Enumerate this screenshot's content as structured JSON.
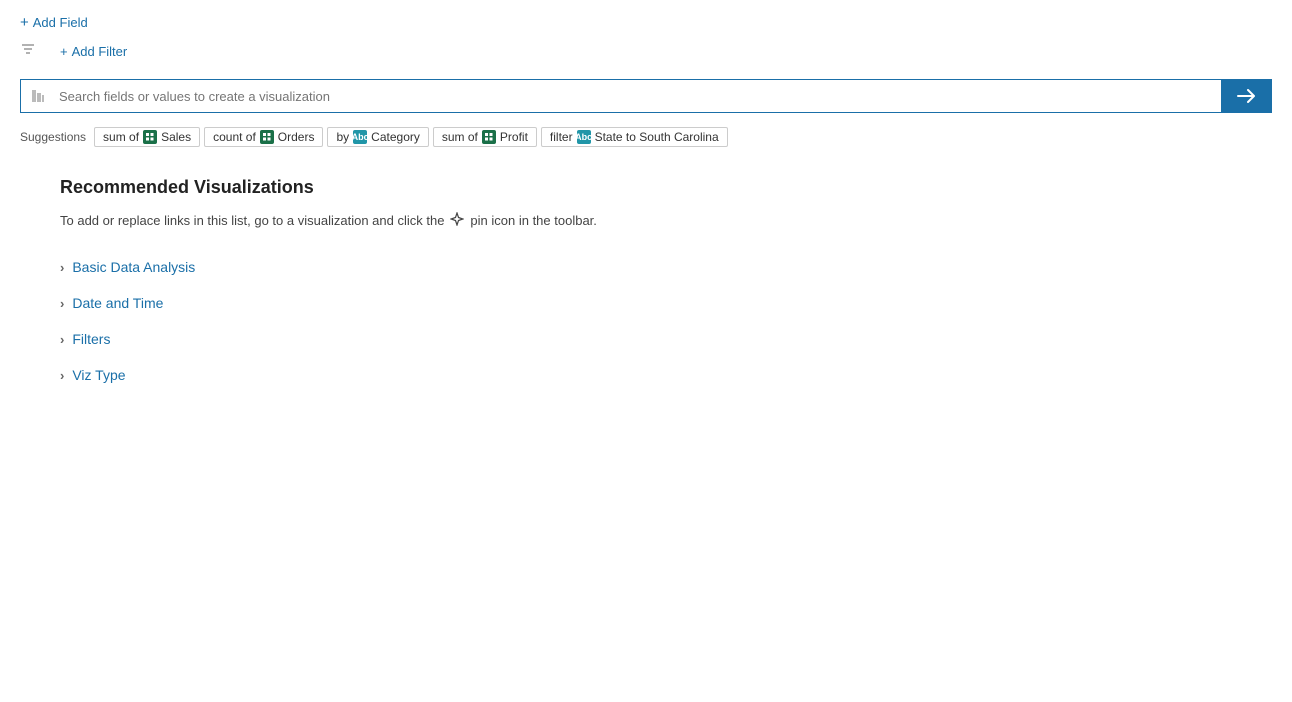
{
  "toolbar": {
    "add_field_label": "Add Field",
    "add_filter_label": "Add Filter"
  },
  "search": {
    "placeholder": "Search fields or values to create a visualization",
    "submit_arrow": "→"
  },
  "suggestions": {
    "label": "Suggestions",
    "chips": [
      {
        "id": "sum-sales",
        "prefix": "sum of",
        "icon_type": "measure",
        "label": "Sales"
      },
      {
        "id": "count-orders",
        "prefix": "count of",
        "icon_type": "measure",
        "label": "Orders"
      },
      {
        "id": "by-category",
        "prefix": "by",
        "icon_type": "dimension",
        "label": "Category"
      },
      {
        "id": "sum-profit",
        "prefix": "sum of",
        "icon_type": "measure",
        "label": "Profit"
      },
      {
        "id": "filter-state",
        "prefix": "filter",
        "icon_type": "dimension",
        "label": "State to South Carolina"
      }
    ]
  },
  "recommended": {
    "title": "Recommended Visualizations",
    "description_parts": [
      "To add or replace links in this list, go to a visualization and click the",
      "pin icon in the toolbar."
    ],
    "items": [
      {
        "id": "basic-data-analysis",
        "label": "Basic Data Analysis"
      },
      {
        "id": "date-and-time",
        "label": "Date and Time"
      },
      {
        "id": "filters",
        "label": "Filters"
      },
      {
        "id": "viz-type",
        "label": "Viz Type"
      }
    ]
  },
  "icons": {
    "plus": "+",
    "filter": "⊘",
    "chevron": "›",
    "pin": "✦",
    "search_cursor": "|",
    "arrow_right": "→"
  }
}
